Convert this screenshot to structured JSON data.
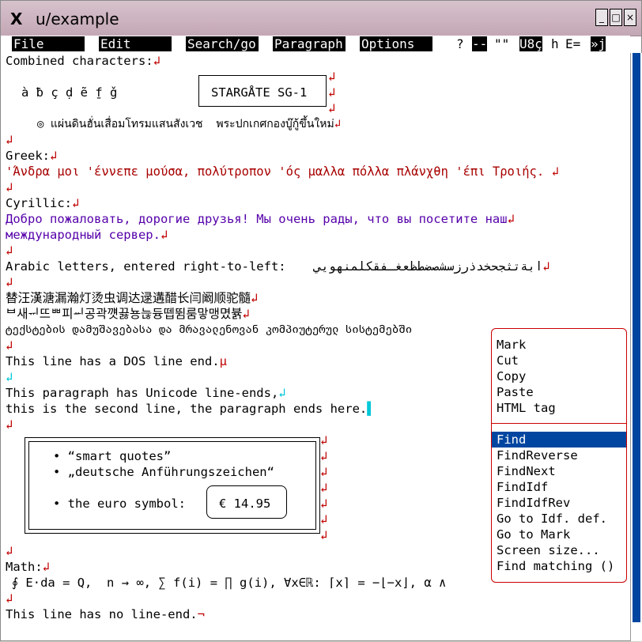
{
  "window": {
    "title": "u/example",
    "title_icon": "X"
  },
  "menubar": {
    "items": [
      "File",
      "Edit",
      "Search/go",
      "Paragraph",
      "Options"
    ],
    "status": {
      "question": "?",
      "dashes": "--",
      "quotes": "\"\"",
      "encoding": "U8ç",
      "h": "h",
      "e": "E=",
      "mark": "»j"
    }
  },
  "lines": [
    "Combined characters:",
    "STARGÅTE SG-1",
    "à ƀ ç ḍ ẽ f̱ ǧ",
    "◎ แผ่นดินฮั่นเสื่อมโทรมแสนสังเวช  พระปกเกศกองบู๊กู้ขึ้นใหม่",
    "Greek:",
    "'Άνδρα μοι 'έννεπε μούσα, πολύτροπον 'ός μαλλα πόλλα πλάνχθη 'έπι Τροιής.",
    "Cyrillic:",
    "Добро пожаловать, дорогие друзья! Мы очень рады, что вы посетите наш",
    "международный сервер.",
    "Arabic letters, entered right-to-left:",
    "ابةتثجحخدذرزسشصضطظعغـفقكلمنهويي",
    "替汪漢溏漏瀚灯烫虫调达逯遘醋长闫阚顺驼髓",
    "ᄇ새ᆔ뜨ᄈ피ᆈ공곽꺳끓뇽늖듕뗍뜀룸맣맹몄뷹",
    "ტექსტების დამუშავებასა და მრავალენოვან კომპიუტერულ სისტემებში",
    "This line has a DOS line end.",
    "This paragraph has Unicode line-ends,",
    "this is the second line, the paragraph ends here.",
    "“smart quotes”",
    "„deutsche Anführungszeichen“",
    "the euro symbol:",
    "€ 14.95",
    "Math:",
    "∮ E⋅da = Q,  n → ∞, ∑ f(i) = ∏ g(i), ∀x∈ℝ: ⌈x⌉ = −⌊−x⌋, α ∧",
    "This line has no line-end."
  ],
  "popup": {
    "items": [
      "Mark",
      "Cut",
      "Copy",
      "Paste",
      "HTML tag",
      "Find",
      "FindReverse",
      "FindNext",
      "FindIdf",
      "FindIdfRev",
      "Go to Idf. def.",
      "Go to Mark",
      "Screen size...",
      "Find matching ()"
    ],
    "selected": "Find"
  },
  "colors": {
    "titlebar": "#c8aebb",
    "accent": "#0046a0",
    "paragraph_mark": "#c00000",
    "greek": "#a80000",
    "cyrillic": "#5500aa"
  }
}
